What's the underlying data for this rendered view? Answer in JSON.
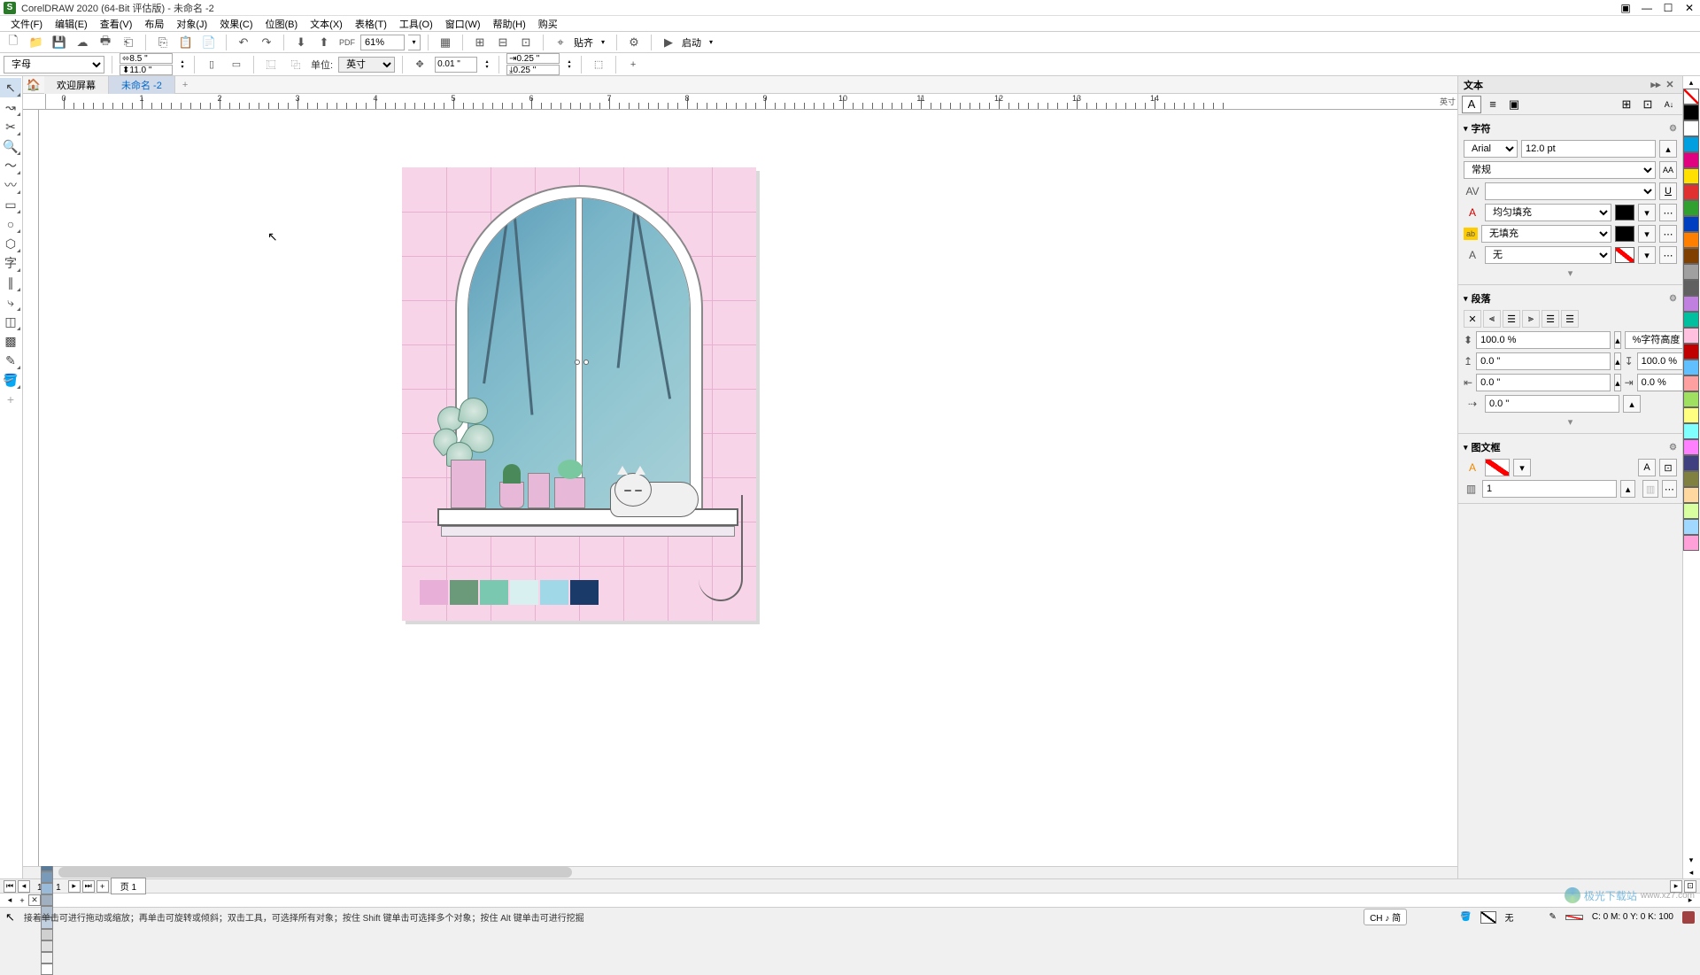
{
  "title": "CorelDRAW 2020 (64-Bit 评估版) - 未命名 -2",
  "menu": [
    "文件(F)",
    "编辑(E)",
    "查看(V)",
    "布局",
    "对象(J)",
    "效果(C)",
    "位图(B)",
    "文本(X)",
    "表格(T)",
    "工具(O)",
    "窗口(W)",
    "帮助(H)",
    "购买"
  ],
  "toolbar1": {
    "zoom": "61%",
    "snap": "贴齐",
    "launch": "启动"
  },
  "toolbar2": {
    "font": "字母",
    "width": "8.5 \"",
    "height": "11.0 \"",
    "unit_label": "单位:",
    "unit": "英寸",
    "nudge": "0.01 \"",
    "dup_x": "0.25 \"",
    "dup_y": "0.25 \""
  },
  "tabs": {
    "welcome": "欢迎屏幕",
    "doc": "未命名 -2"
  },
  "ruler_unit": "英寸",
  "page_nav": {
    "pos": "1 的 1",
    "page": "页 1"
  },
  "right": {
    "title": "文本",
    "sec1": "字符",
    "font_name": "Arial",
    "font_size": "12.0 pt",
    "font_style": "常规",
    "fill_label": "均匀填充",
    "outline_label": "无填充",
    "effect_label": "无",
    "sec2": "段落",
    "line_spacing": "100.0 %",
    "line_unit": "%字符高度",
    "before": "0.0 \"",
    "after": "100.0 %",
    "left_indent": "0.0 \"",
    "right_indent": "0.0 %",
    "first_line": "0.0 \"",
    "sec3": "图文框",
    "columns": "1"
  },
  "status": {
    "hint": "接着单击可进行拖动或缩放；再单击可旋转或倾斜；双击工具，可选择所有对象；按住 Shift 键单击可选择多个对象；按住 Alt 键单击可进行挖掘",
    "lang": "CH ♪ 简",
    "fill_label": "无",
    "coords": "C: 0 M: 0 Y: 0 K: 100"
  },
  "palette_colors": [
    "#000000",
    "#ffffff",
    "#00a0e0",
    "#e00080",
    "#ffe000",
    "#e03030",
    "#30a030",
    "#0040c0",
    "#ff8000",
    "#804000",
    "#a0a0a0",
    "#606060",
    "#c080e0",
    "#00c0a0",
    "#ffc0e0",
    "#c00000",
    "#60c0ff",
    "#ffa0a0",
    "#a0e060",
    "#ffff80",
    "#80ffff",
    "#ff80ff",
    "#404080",
    "#808040",
    "#ffd8a0",
    "#d8ffa0",
    "#a0d8ff",
    "#ffa0d8"
  ],
  "bottom_palette": [
    "#000000",
    "#1a3a5a",
    "#3a5a7a",
    "#5a7a9a",
    "#7a9aba",
    "#9abada",
    "#a0b0c0",
    "#b0c0d0",
    "#c0d0e0",
    "#d0d0d0",
    "#e0e0e0",
    "#f0f0f0",
    "#ffffff"
  ],
  "artwork_swatches": [
    "#e8b0d8",
    "#6a9a7a",
    "#7ac8b0",
    "#d8f0f0",
    "#a0d8e8",
    "#1a3a6a"
  ],
  "watermark": "极光下载站"
}
